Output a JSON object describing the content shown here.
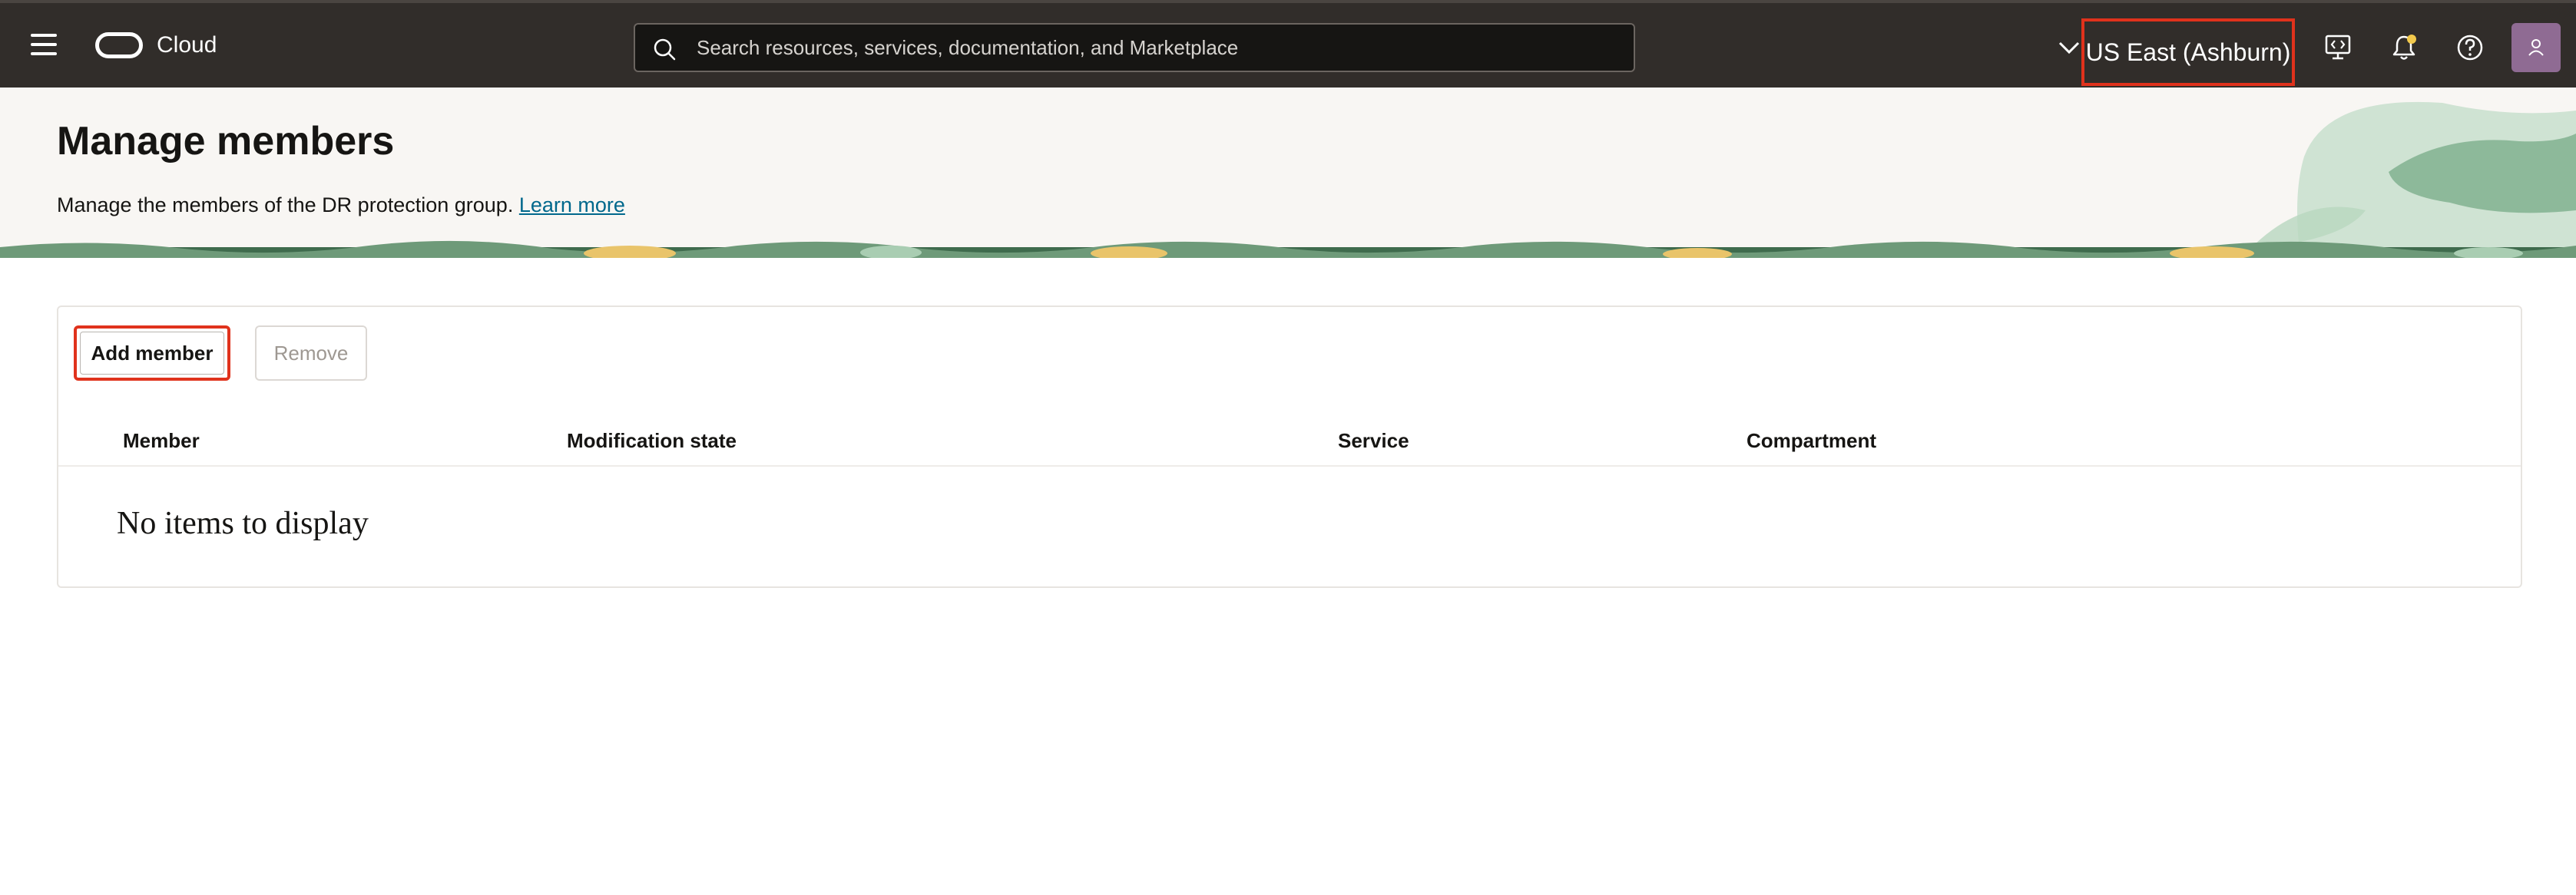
{
  "topbar": {
    "brand": "Cloud",
    "search": {
      "placeholder": "Search resources, services, documentation, and Marketplace"
    },
    "region_label": "US East (Ashburn)",
    "icons": [
      "menu-icon",
      "oracle-logo",
      "search-icon",
      "chevron-down-icon",
      "developer-tools-icon",
      "bell-icon",
      "help-icon",
      "user-icon"
    ],
    "colors": {
      "bar": "#312d2a",
      "highlight": "#e0321c",
      "avatar": "#8f6b93",
      "notification_dot": "#f2c94c"
    }
  },
  "header": {
    "title": "Manage members",
    "description": "Manage the members of the DR protection group.",
    "learn_more": "Learn more"
  },
  "toolbar": {
    "add_label": "Add member",
    "remove_label": "Remove"
  },
  "table": {
    "columns": [
      "Member",
      "Modification state",
      "Service",
      "Compartment"
    ],
    "rows": [],
    "empty_message": "No items to display"
  }
}
